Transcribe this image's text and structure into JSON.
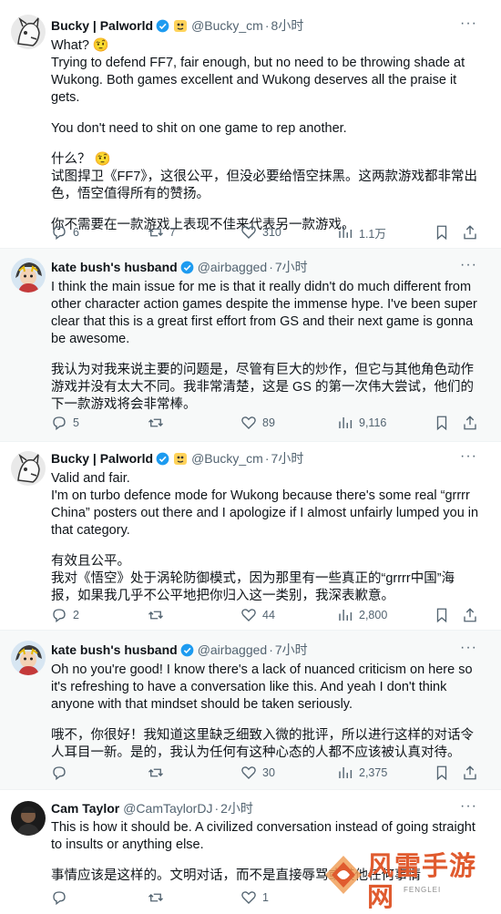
{
  "tweets": [
    {
      "name": "Bucky | Palworld",
      "handle": "@Bucky_cm",
      "time": "8小时",
      "body": [
        "What? 🤨",
        "Trying to defend FF7, fair enough, but no need to be throwing shade at Wukong. Both games excellent and Wukong deserves all the praise it gets.",
        "",
        "You don't need to shit on one game to rep another.",
        "",
        "什么？ 🤨",
        "试图捍卫《FF7》，这很公平，但没必要给悟空抹黑。这两款游戏都非常出色，悟空值得所有的赞扬。",
        "",
        "你不需要在一款游戏上表现不佳来代表另一款游戏。"
      ],
      "replies": "6",
      "reposts": "7",
      "likes": "310",
      "views": "1.1万"
    },
    {
      "name": "kate bush's husband",
      "handle": "@airbagged",
      "time": "7小时",
      "body": [
        "I think the main issue for me is that it really didn't do much different from other character action games despite the immense hype.  I've been super clear that this is a great first effort from GS and their next game is gonna be awesome.",
        "",
        "我认为对我来说主要的问题是，尽管有巨大的炒作，但它与其他角色动作游戏并没有太大不同。我非常清楚，这是 GS 的第一次伟大尝试，他们的下一款游戏将会非常棒。"
      ],
      "replies": "5",
      "reposts": "",
      "likes": "89",
      "views": "9,116"
    },
    {
      "name": "Bucky | Palworld",
      "handle": "@Bucky_cm",
      "time": "7小时",
      "body": [
        "Valid and fair.",
        "I'm on turbo defence mode for Wukong because there's some real “grrrr China” posters out there and I apologize if I almost unfairly lumped you in that category.",
        "",
        "有效且公平。",
        "我对《悟空》处于涡轮防御模式，因为那里有一些真正的“grrrr中国”海报，如果我几乎不公平地把你归入这一类别，我深表歉意。"
      ],
      "replies": "2",
      "reposts": "",
      "likes": "44",
      "views": "2,800"
    },
    {
      "name": "kate bush's husband",
      "handle": "@airbagged",
      "time": "7小时",
      "body": [
        "Oh no you're good! I know there's a lack of nuanced criticism on here so it's refreshing to have a conversation like this.  And yeah I don't think anyone with that mindset should be taken seriously.",
        "",
        "哦不，你很好！我知道这里缺乏细致入微的批评，所以进行这样的对话令人耳目一新。是的，我认为任何有这种心态的人都不应该被认真对待。"
      ],
      "replies": "",
      "reposts": "",
      "likes": "30",
      "views": "2,375"
    },
    {
      "name": "Cam Taylor",
      "handle": "@CamTaylorDJ",
      "time": "2小时",
      "body": [
        "This is how it should be. A civilized conversation instead of going straight to insults or anything else.",
        "",
        "事情应该是这样的。文明对话，而不是直接辱骂或其他任何事情"
      ],
      "replies": "",
      "reposts": "",
      "likes": "1",
      "views": ""
    }
  ],
  "watermark": {
    "text": "风雷手游网",
    "sub": "FENGLEI"
  },
  "icons": [
    "reply-icon",
    "repost-icon",
    "like-icon",
    "views-icon",
    "bookmark-icon",
    "share-icon",
    "more-icon",
    "verified-badge-icon"
  ],
  "colors": {
    "verified": "#1d9bf0",
    "muted": "#536471",
    "divider": "#eff3f4",
    "shaded_bg": "#f7f9f9",
    "watermark": "#e05b2f"
  }
}
